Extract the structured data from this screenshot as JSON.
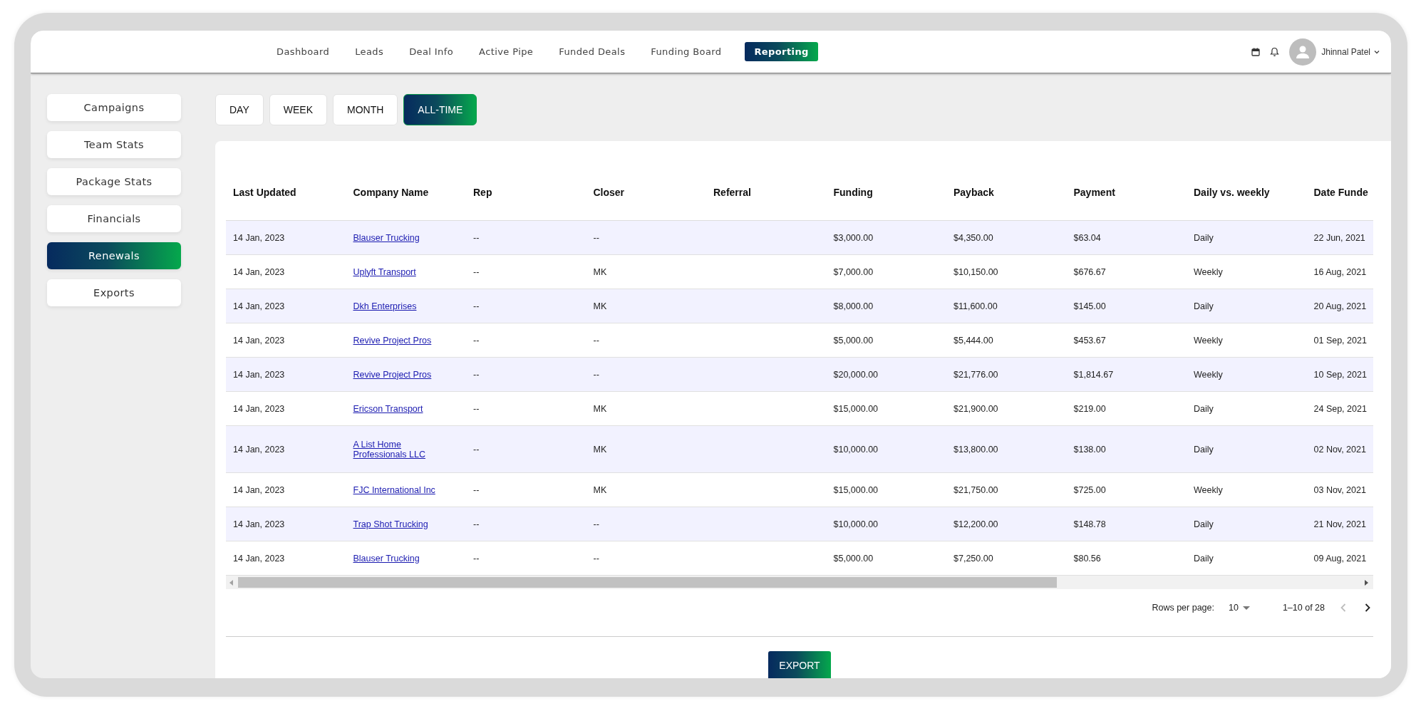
{
  "nav": {
    "items": [
      {
        "label": "Dashboard",
        "selected": false
      },
      {
        "label": "Leads",
        "selected": false
      },
      {
        "label": "Deal Info",
        "selected": false
      },
      {
        "label": "Active Pipe",
        "selected": false
      },
      {
        "label": "Funded Deals",
        "selected": false
      },
      {
        "label": "Funding Board",
        "selected": false
      },
      {
        "label": "Reporting",
        "selected": true
      }
    ],
    "user": {
      "name": "Jhinnal Patel"
    }
  },
  "sidebar": {
    "items": [
      {
        "label": "Campaigns",
        "selected": false
      },
      {
        "label": "Team Stats",
        "selected": false
      },
      {
        "label": "Package Stats",
        "selected": false
      },
      {
        "label": "Financials",
        "selected": false
      },
      {
        "label": "Renewals",
        "selected": true
      },
      {
        "label": "Exports",
        "selected": false
      }
    ]
  },
  "periods": [
    {
      "label": "DAY",
      "selected": false
    },
    {
      "label": "WEEK",
      "selected": false
    },
    {
      "label": "MONTH",
      "selected": false
    },
    {
      "label": "ALL-TIME",
      "selected": true
    }
  ],
  "table": {
    "columns": [
      {
        "label": "Last Updated",
        "kind": "text"
      },
      {
        "label": "Company Name",
        "kind": "link"
      },
      {
        "label": "Rep",
        "kind": "text"
      },
      {
        "label": "Closer",
        "kind": "text"
      },
      {
        "label": "Referral",
        "kind": "text"
      },
      {
        "label": "Funding",
        "kind": "text"
      },
      {
        "label": "Payback",
        "kind": "text"
      },
      {
        "label": "Payment",
        "kind": "text"
      },
      {
        "label": "Daily vs. weekly",
        "kind": "text"
      },
      {
        "label": "Date Funde",
        "kind": "text"
      }
    ],
    "rows": [
      {
        "cells": [
          "14 Jan, 2023",
          "Blauser Trucking",
          "--",
          "--",
          "",
          "$3,000.00",
          "$4,350.00",
          "$63.04",
          "Daily",
          "22 Jun, 2021"
        ]
      },
      {
        "cells": [
          "14 Jan, 2023",
          "Uplyft Transport",
          "--",
          "MK",
          "",
          "$7,000.00",
          "$10,150.00",
          "$676.67",
          "Weekly",
          "16 Aug, 2021"
        ]
      },
      {
        "cells": [
          "14 Jan, 2023",
          "Dkh Enterprises",
          "--",
          "MK",
          "",
          "$8,000.00",
          "$11,600.00",
          "$145.00",
          "Daily",
          "20 Aug, 2021"
        ]
      },
      {
        "cells": [
          "14 Jan, 2023",
          "Revive Project Pros",
          "--",
          "--",
          "",
          "$5,000.00",
          "$5,444.00",
          "$453.67",
          "Weekly",
          "01 Sep, 2021"
        ]
      },
      {
        "cells": [
          "14 Jan, 2023",
          "Revive Project Pros",
          "--",
          "--",
          "",
          "$20,000.00",
          "$21,776.00",
          "$1,814.67",
          "Weekly",
          "10 Sep, 2021"
        ]
      },
      {
        "cells": [
          "14 Jan, 2023",
          "Ericson Transport",
          "--",
          "MK",
          "",
          "$15,000.00",
          "$21,900.00",
          "$219.00",
          "Daily",
          "24 Sep, 2021"
        ]
      },
      {
        "cells": [
          "14 Jan, 2023",
          "A List Home Professionals LLC",
          "--",
          "MK",
          "",
          "$10,000.00",
          "$13,800.00",
          "$138.00",
          "Daily",
          "02 Nov, 2021"
        ]
      },
      {
        "cells": [
          "14 Jan, 2023",
          "FJC International Inc",
          "--",
          "MK",
          "",
          "$15,000.00",
          "$21,750.00",
          "$725.00",
          "Weekly",
          "03 Nov, 2021"
        ]
      },
      {
        "cells": [
          "14 Jan, 2023",
          "Trap Shot Trucking",
          "--",
          "--",
          "",
          "$10,000.00",
          "$12,200.00",
          "$148.78",
          "Daily",
          "21 Nov, 2021"
        ]
      },
      {
        "cells": [
          "14 Jan, 2023",
          "Blauser Trucking",
          "--",
          "--",
          "",
          "$5,000.00",
          "$7,250.00",
          "$80.56",
          "Daily",
          "09 Aug, 2021"
        ]
      }
    ]
  },
  "pagination": {
    "rows_per_page_label": "Rows per page:",
    "rows_per_page": "10",
    "range": "1–10 of 28",
    "prev_disabled": true,
    "next_disabled": false
  },
  "export_button": "EXPORT"
}
